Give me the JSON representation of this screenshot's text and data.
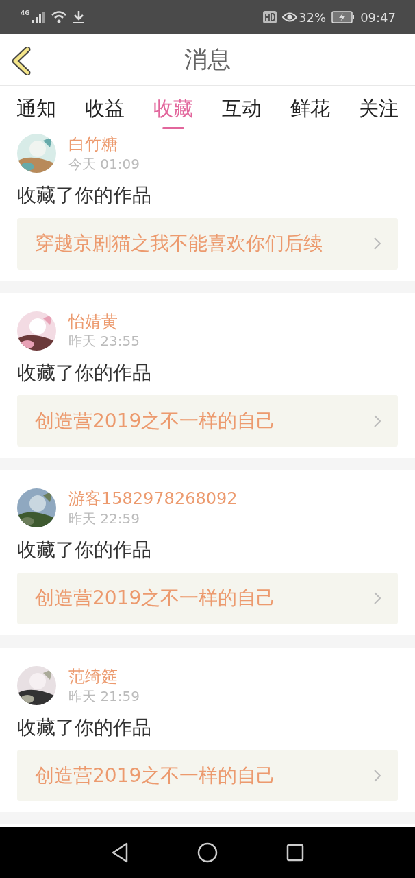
{
  "status_bar": {
    "network": "4G",
    "battery_percent": "32%",
    "time": "09:47"
  },
  "header": {
    "title": "消息"
  },
  "tabs": [
    {
      "label": "通知",
      "selected": false
    },
    {
      "label": "收益",
      "selected": false
    },
    {
      "label": "收藏",
      "selected": true
    },
    {
      "label": "互动",
      "selected": false
    },
    {
      "label": "鲜花",
      "selected": false
    },
    {
      "label": "关注",
      "selected": false
    }
  ],
  "messages": [
    {
      "user": "白竹糖",
      "time": "今天 01:09",
      "action": "收藏了你的作品",
      "work": "穿越京剧猫之我不能喜欢你们后续"
    },
    {
      "user": "怡婧黄",
      "time": "昨天 23:55",
      "action": "收藏了你的作品",
      "work": "创造营2019之不一样的自己"
    },
    {
      "user": "游客1582978268092",
      "time": "昨天 22:59",
      "action": "收藏了你的作品",
      "work": "创造营2019之不一样的自己"
    },
    {
      "user": "范绮筵",
      "time": "昨天 21:59",
      "action": "收藏了你的作品",
      "work": "创造营2019之不一样的自己"
    }
  ]
}
